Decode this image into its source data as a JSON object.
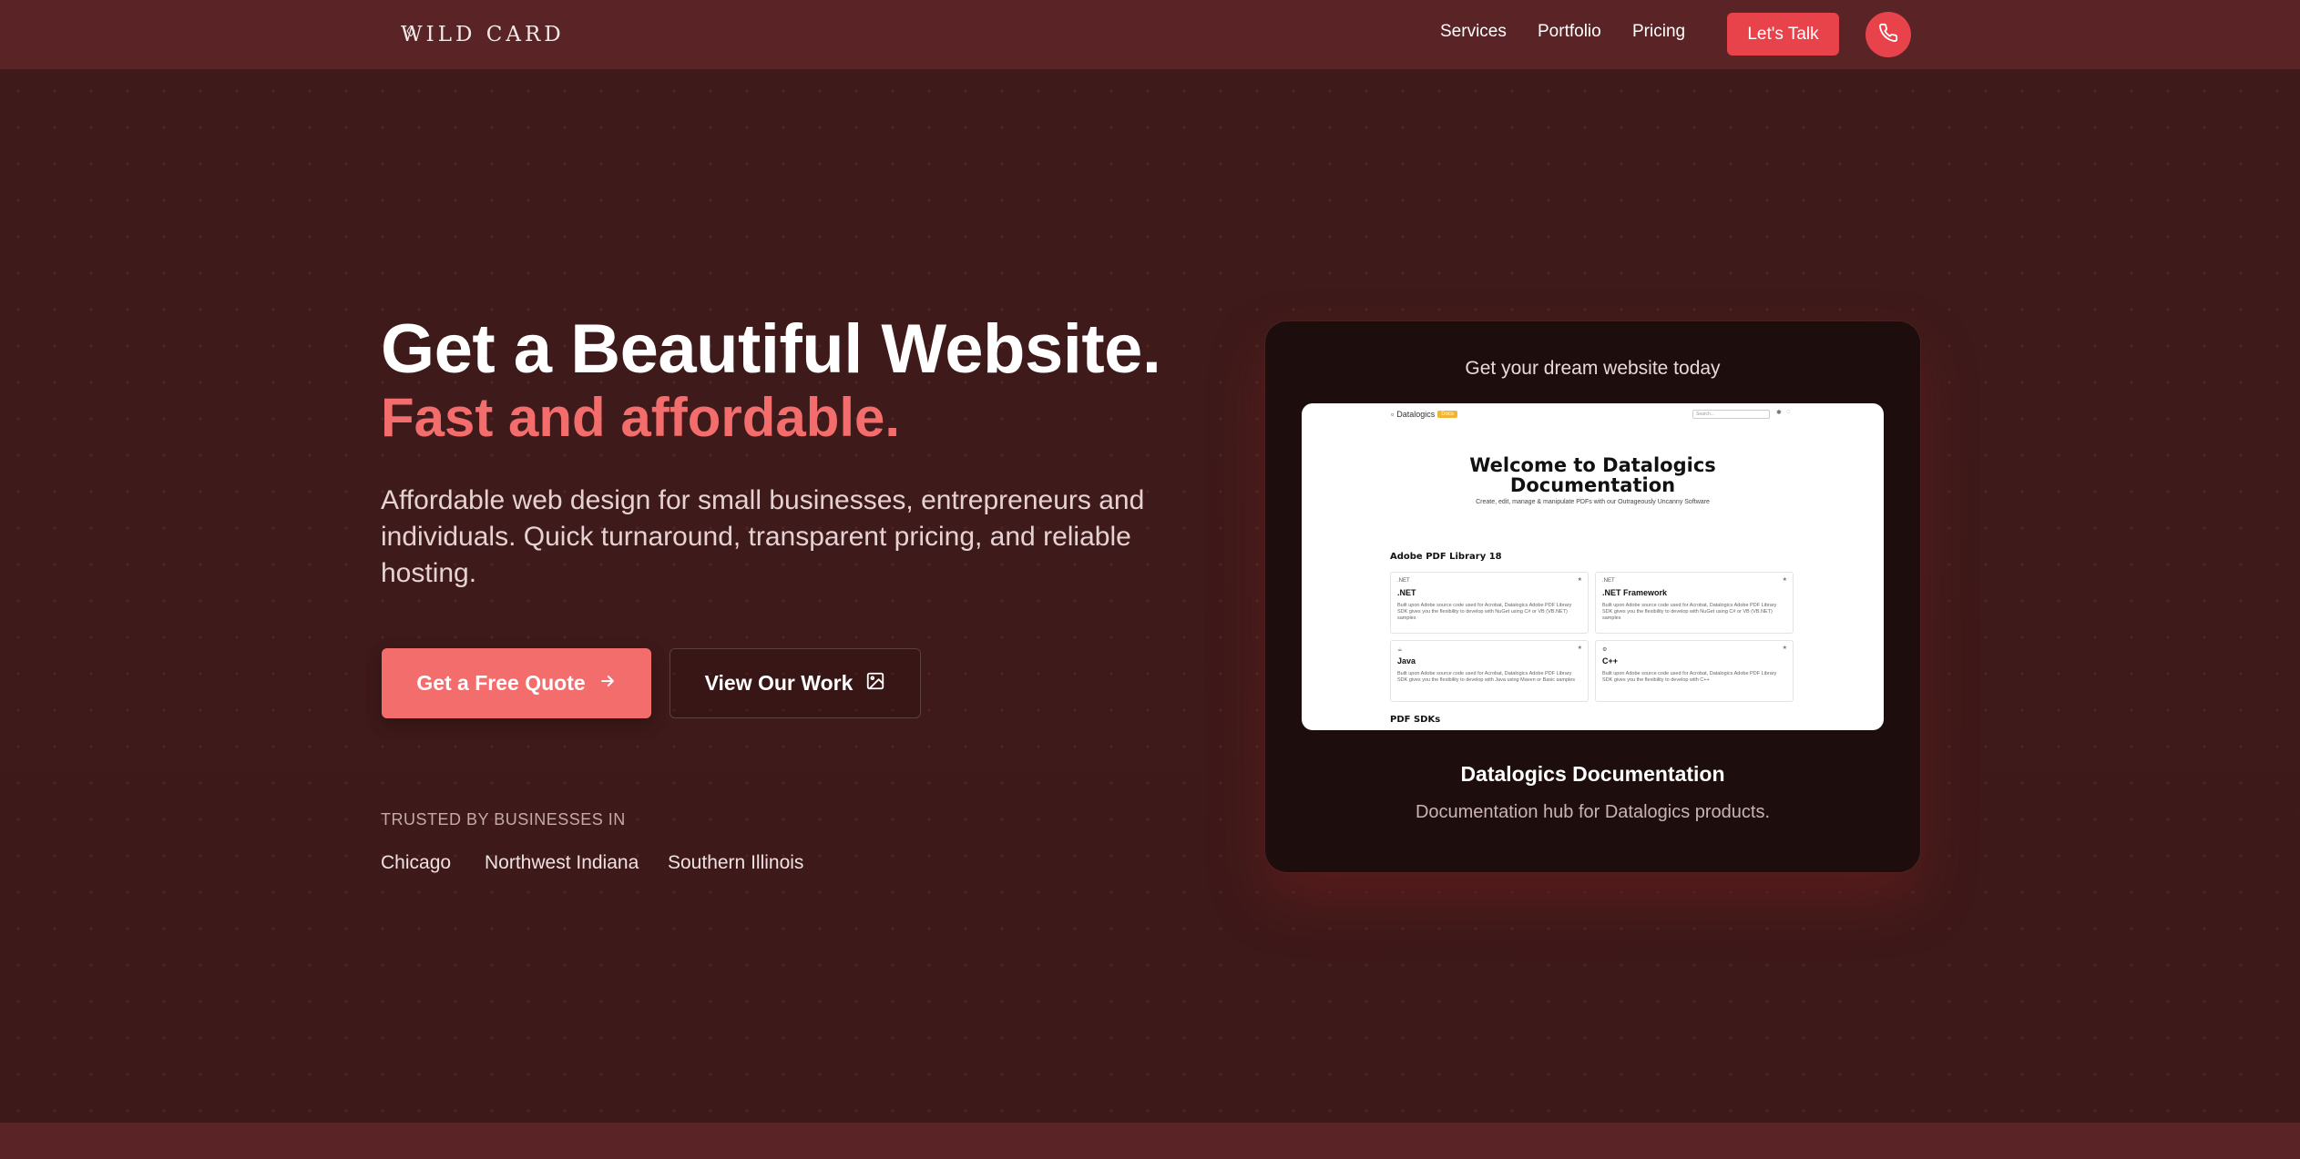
{
  "header": {
    "logo_text": "WILD CARD",
    "nav": [
      "Services",
      "Portfolio",
      "Pricing"
    ],
    "cta_label": "Let's Talk",
    "phone_icon": "phone-icon"
  },
  "hero": {
    "title_line1": "Get a Beautiful Website.",
    "title_line2": "Fast and affordable.",
    "lead": "Affordable web design for small businesses, entrepreneurs and individuals. Quick turnaround, transparent pricing, and reliable hosting.",
    "primary_button": "Get a Free Quote",
    "primary_icon": "arrow-right-icon",
    "secondary_button": "View Our Work",
    "secondary_icon": "image-icon",
    "trusted_label": "TRUSTED BY BUSINESSES IN",
    "cities": [
      "Chicago",
      "Northwest Indiana",
      "Southern Illinois"
    ]
  },
  "showcase": {
    "top_text": "Get your dream website today",
    "title": "Datalogics Documentation",
    "description": "Documentation hub for Datalogics products.",
    "screenshot": {
      "brand": "Datalogics",
      "badge": "Docs",
      "search_placeholder": "Search...",
      "heading_line1": "Welcome to Datalogics",
      "heading_line2": "Documentation",
      "subheading": "Create, edit, manage & manipulate PDFs with our Outrageously Uncanny Software",
      "section1": "Adobe PDF Library 18",
      "cards": [
        {
          "icon": ".NET",
          "title": ".NET",
          "desc": "Built upon Adobe source code used for Acrobat, Datalogics Adobe PDF Library SDK gives you the flexibility to develop with NuGet using C# or VB (VB.NET) samples"
        },
        {
          "icon": ".NET",
          "title": ".NET Framework",
          "desc": "Built upon Adobe source code used for Acrobat, Datalogics Adobe PDF Library SDK gives you the flexibility to develop with NuGet using C# or VB (VB.NET) samples"
        },
        {
          "icon": "☕",
          "title": "Java",
          "desc": "Built upon Adobe source code used for Acrobat, Datalogics Adobe PDF Library SDK gives you the flexibility to develop with Java using Maven or Basic samples"
        },
        {
          "icon": "⚙",
          "title": "C++",
          "desc": "Built upon Adobe source code used for Acrobat, Datalogics Adobe PDF Library SDK gives you the flexibility to develop with C++"
        }
      ],
      "section2": "PDF SDKs"
    }
  },
  "colors": {
    "accent": "#e8424a",
    "accent_soft": "#f36d6d",
    "background": "#3f1a1a",
    "header": "#5a2325",
    "card": "#1e0d0d"
  }
}
